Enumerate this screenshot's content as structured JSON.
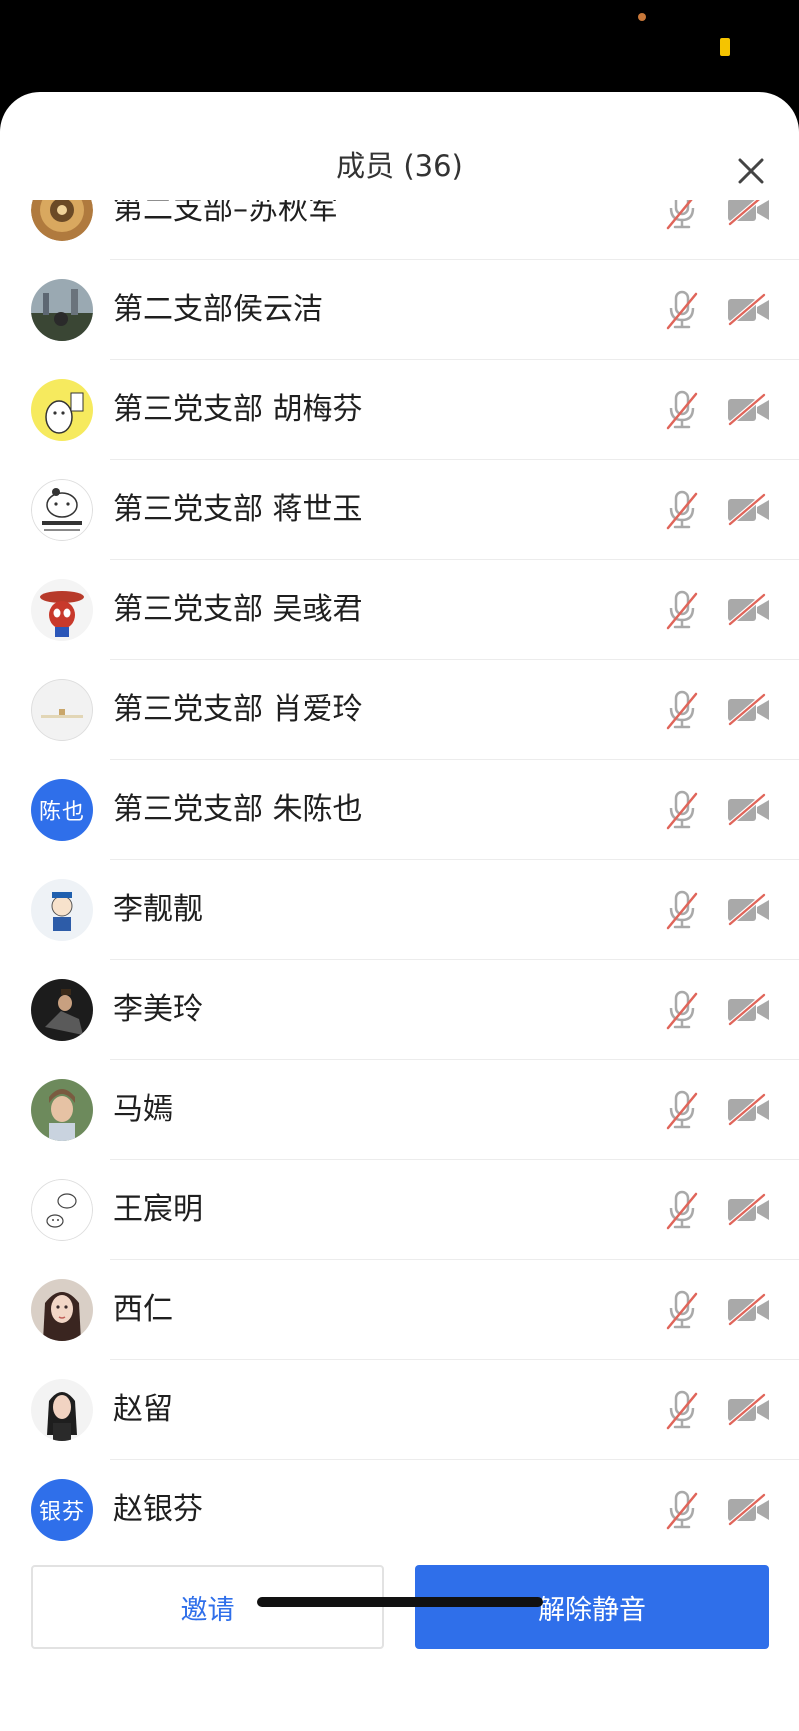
{
  "header": {
    "title": "成员 (36)"
  },
  "colors": {
    "accent": "#2f6fea",
    "muted_red": "#e0655a",
    "icon_gray": "#a9a9a9"
  },
  "members": [
    {
      "name": "第二支部–苏秋军",
      "avatar": "photo-ornament"
    },
    {
      "name": "第二支部侯云洁",
      "avatar": "photo-landscape"
    },
    {
      "name": "第三党支部 胡梅芬",
      "avatar": "cartoon-yellow"
    },
    {
      "name": "第三党支部 蒋世玉",
      "avatar": "cartoon-cat"
    },
    {
      "name": "第三党支部 吴彧君",
      "avatar": "cartoon-spiderman"
    },
    {
      "name": "第三党支部 肖爱玲",
      "avatar": "photo-light"
    },
    {
      "name": "第三党支部 朱陈也",
      "avatar_text": "陈也"
    },
    {
      "name": "李靓靓",
      "avatar": "cartoon-child"
    },
    {
      "name": "李美玲",
      "avatar": "photo-dark"
    },
    {
      "name": "马嫣",
      "avatar": "photo-portrait"
    },
    {
      "name": "王宸明",
      "avatar": "cartoon-line"
    },
    {
      "name": "西仁",
      "avatar": "photo-girl"
    },
    {
      "name": "赵留",
      "avatar": "photo-woman"
    },
    {
      "name": "赵银芬",
      "avatar_text": "银芬"
    }
  ],
  "footer": {
    "invite_label": "邀请",
    "unmute_label": "解除静音"
  }
}
